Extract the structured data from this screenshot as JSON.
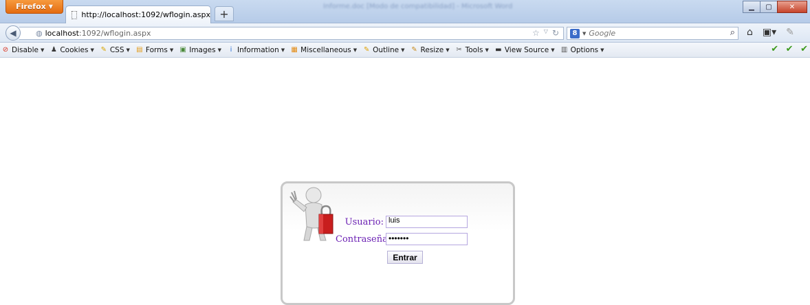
{
  "browser": {
    "menu_button": "Firefox",
    "tab_title": "http://localhost:1092/wflogin.aspx",
    "new_tab": "+",
    "window_title": "Informe.doc [Modo de compatibilidad] - Microsoft Word",
    "url_host": "localhost",
    "url_path": ":1092/wflogin.aspx",
    "search_placeholder": "Google",
    "search_engine_letter": "8"
  },
  "devtoolbar": {
    "items": [
      {
        "label": "Disable",
        "icon": "disable-icon",
        "color": "#d8321f",
        "glyph": "⊘"
      },
      {
        "label": "Cookies",
        "icon": "cookies-icon",
        "color": "#3a3a3a",
        "glyph": "♟"
      },
      {
        "label": "CSS",
        "icon": "css-icon",
        "color": "#d9a400",
        "glyph": "✎"
      },
      {
        "label": "Forms",
        "icon": "forms-icon",
        "color": "#e39a17",
        "glyph": "▤"
      },
      {
        "label": "Images",
        "icon": "images-icon",
        "color": "#4c8a3c",
        "glyph": "▣"
      },
      {
        "label": "Information",
        "icon": "information-icon",
        "color": "#2a6fd6",
        "glyph": "i"
      },
      {
        "label": "Miscellaneous",
        "icon": "miscellaneous-icon",
        "color": "#e38a12",
        "glyph": "▦"
      },
      {
        "label": "Outline",
        "icon": "outline-icon",
        "color": "#e0a000",
        "glyph": "✎"
      },
      {
        "label": "Resize",
        "icon": "resize-icon",
        "color": "#c98a1c",
        "glyph": "✎"
      },
      {
        "label": "Tools",
        "icon": "tools-icon",
        "color": "#555555",
        "glyph": "✂"
      },
      {
        "label": "View Source",
        "icon": "view-source-icon",
        "color": "#333333",
        "glyph": "▬"
      },
      {
        "label": "Options",
        "icon": "options-icon",
        "color": "#555555",
        "glyph": "▥"
      }
    ]
  },
  "login": {
    "user_label": "Usuario:",
    "user_value": "luis",
    "password_label": "Contraseña:",
    "password_value": "•••••••",
    "submit_label": "Entrar",
    "label_color": "#6a1fb3"
  }
}
